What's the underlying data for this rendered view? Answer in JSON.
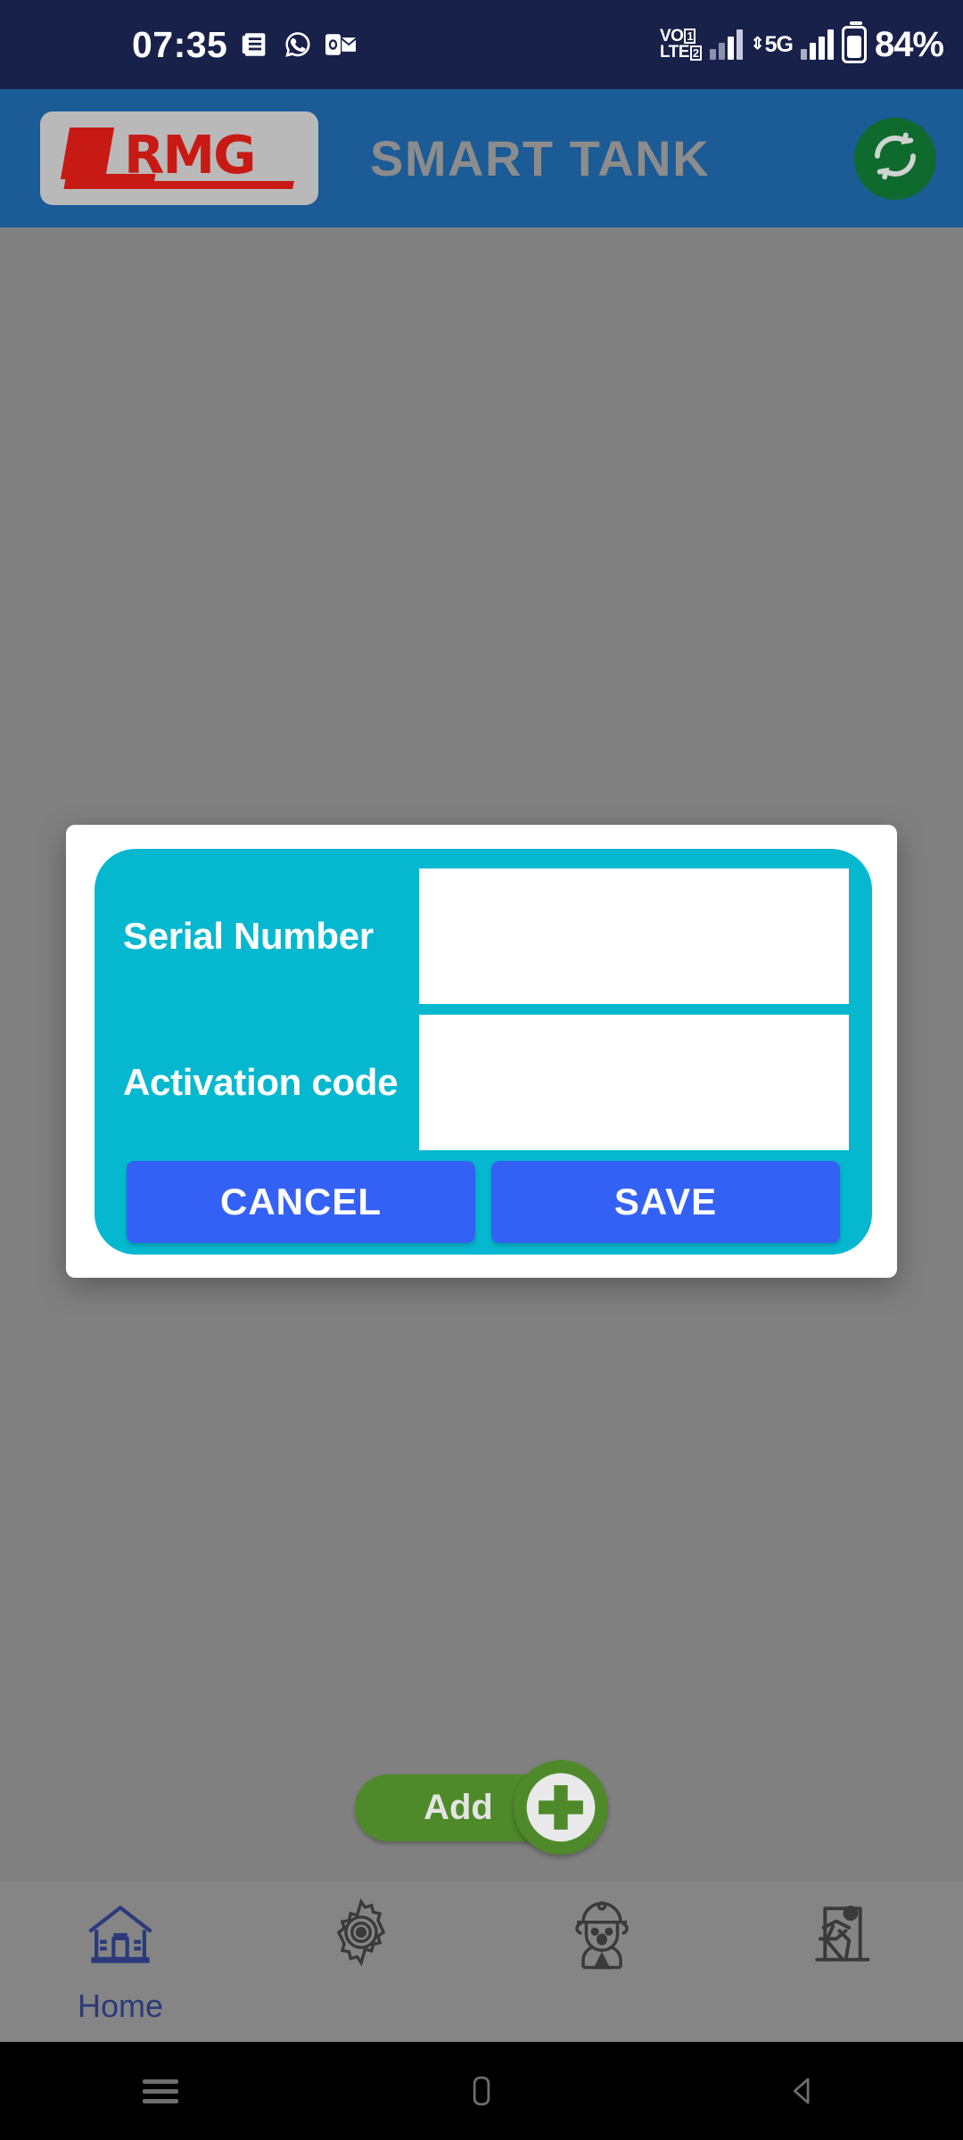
{
  "status_bar": {
    "time": "07:35",
    "battery_percent": "84%",
    "icons": [
      "news-icon",
      "whatsapp-icon",
      "outlook-icon"
    ],
    "network": {
      "volte_top": "VO",
      "volte_bottom": "LTE",
      "sim1": "1",
      "sim2": "2",
      "data_type": "5G"
    },
    "background": "#18214a"
  },
  "header": {
    "logo_text": "RMG",
    "title": "SMART TANK",
    "refresh_label": "refresh-icon",
    "background": "#1b5b96",
    "title_color": "#8c8c8c",
    "logo_color": "#c81a14",
    "refresh_color": "#0f6b2d"
  },
  "dialog": {
    "panel_color": "#05b8cf",
    "button_color": "#3461f5",
    "fields": [
      {
        "label": "Serial Number",
        "value": "",
        "placeholder": ""
      },
      {
        "label": "Activation code",
        "value": "",
        "placeholder": ""
      }
    ],
    "buttons": [
      {
        "label": "CANCEL"
      },
      {
        "label": "SAVE"
      }
    ]
  },
  "add_button": {
    "label": "Add",
    "color": "#4e8a2a",
    "icon": "plus-circle-icon"
  },
  "bottom_nav": {
    "items": [
      {
        "label": "Home",
        "icon": "home-icon",
        "active": true
      },
      {
        "label": "",
        "icon": "gear-icon",
        "active": false
      },
      {
        "label": "",
        "icon": "technician-icon",
        "active": false
      },
      {
        "label": "",
        "icon": "exit-running-icon",
        "active": false
      }
    ],
    "background": "#858585",
    "active_color": "#2b3a7a",
    "inactive_color": "#444444"
  },
  "system_nav": {
    "items": [
      "recents-icon",
      "home-square-icon",
      "back-triangle-icon"
    ],
    "background": "#000000"
  }
}
